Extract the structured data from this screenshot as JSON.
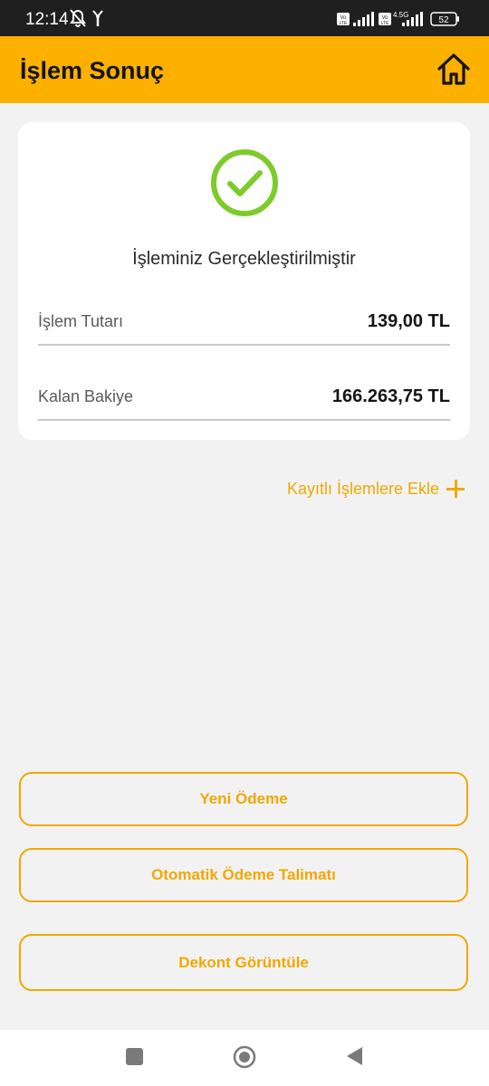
{
  "status_bar": {
    "time": "12:14",
    "network": "4.5G",
    "battery": "52",
    "icons": [
      "muted-bell-icon",
      "signal-antenna-icon",
      "volte-icon",
      "cell-signal-icon",
      "battery-icon"
    ]
  },
  "header": {
    "title": "İşlem Sonuç",
    "home_icon": "home-icon",
    "background": "#fcb000"
  },
  "result": {
    "icon": "success-check-icon",
    "message": "İşleminiz Gerçekleştirilmiştir",
    "rows": [
      {
        "label": "İşlem Tutarı",
        "value": "139,00 TL"
      },
      {
        "label": "Kalan Bakiye",
        "value": "166.263,75 TL"
      }
    ]
  },
  "add_link": {
    "label": "Kayıtlı İşlemlere Ekle",
    "icon": "plus-icon"
  },
  "actions": [
    {
      "label": "Yeni Ödeme"
    },
    {
      "label": "Otomatik Ödeme Talimatı"
    },
    {
      "label": "Dekont Görüntüle"
    }
  ],
  "nav": {
    "icons": [
      "recent-apps-icon",
      "home-circle-icon",
      "back-icon"
    ]
  },
  "colors": {
    "accent": "#f0a800",
    "success": "#7ccb2b"
  }
}
